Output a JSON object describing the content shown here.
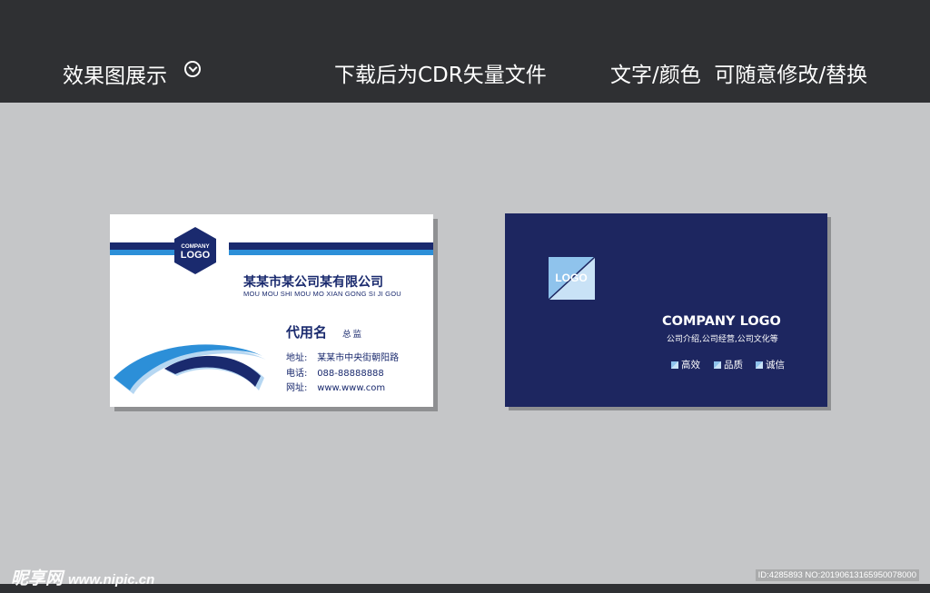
{
  "header": {
    "left_label": "效果图展示",
    "middle_label": "下载后为CDR矢量文件",
    "right_label": "文字/颜色  可随意修改/替换"
  },
  "front_card": {
    "logo_line1": "COMPANY",
    "logo_line2": "LOGO",
    "company_cn": "某某市某公司某有限公司",
    "company_en": "MOU MOU SHI MOU MO XIAN GONG SI JI GOU",
    "person_name": "代用名",
    "person_title": "总监",
    "address_label": "地址:",
    "address_value": "某某市中央街朝阳路",
    "phone_label": "电话:",
    "phone_value": "088-88888888",
    "web_label": "网址:",
    "web_value": "www.www.com"
  },
  "back_card": {
    "logo_text": "LOGO",
    "company": "COMPANY LOGO",
    "description": "公司介绍,公司经营,公司文化等",
    "tags": [
      "高效",
      "品质",
      "诚信"
    ]
  },
  "footer": {
    "watermark": "昵享网",
    "watermark_url": "www.nipic.cn",
    "id_text": "ID:4285893 NO:20190613165950078000"
  },
  "colors": {
    "navy": "#1a2a6e",
    "blue": "#2c8fd8",
    "back_bg": "#1d2660",
    "header_bg": "#2f3033",
    "page_bg": "#c5c6c8"
  }
}
